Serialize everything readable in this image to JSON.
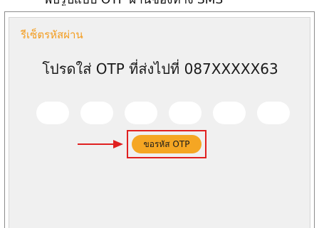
{
  "top_partial_text": "พบรูปแบบ OTP ผ่านช่องทาง SMS",
  "card": {
    "title": "รีเซ็ตรหัสผ่าน",
    "instruction": "โปรดใส่ OTP ที่ส่งไปที่ 087XXXXX63",
    "otp_fields": [
      "",
      "",
      "",
      "",
      "",
      ""
    ],
    "request_otp_label": "ขอรหัส OTP"
  },
  "colors": {
    "title": "#f39c1e",
    "button": "#f5a623",
    "highlight": "#e02020",
    "card_bg": "#f0f0f0"
  },
  "icons": [
    "arrow-right-icon"
  ]
}
